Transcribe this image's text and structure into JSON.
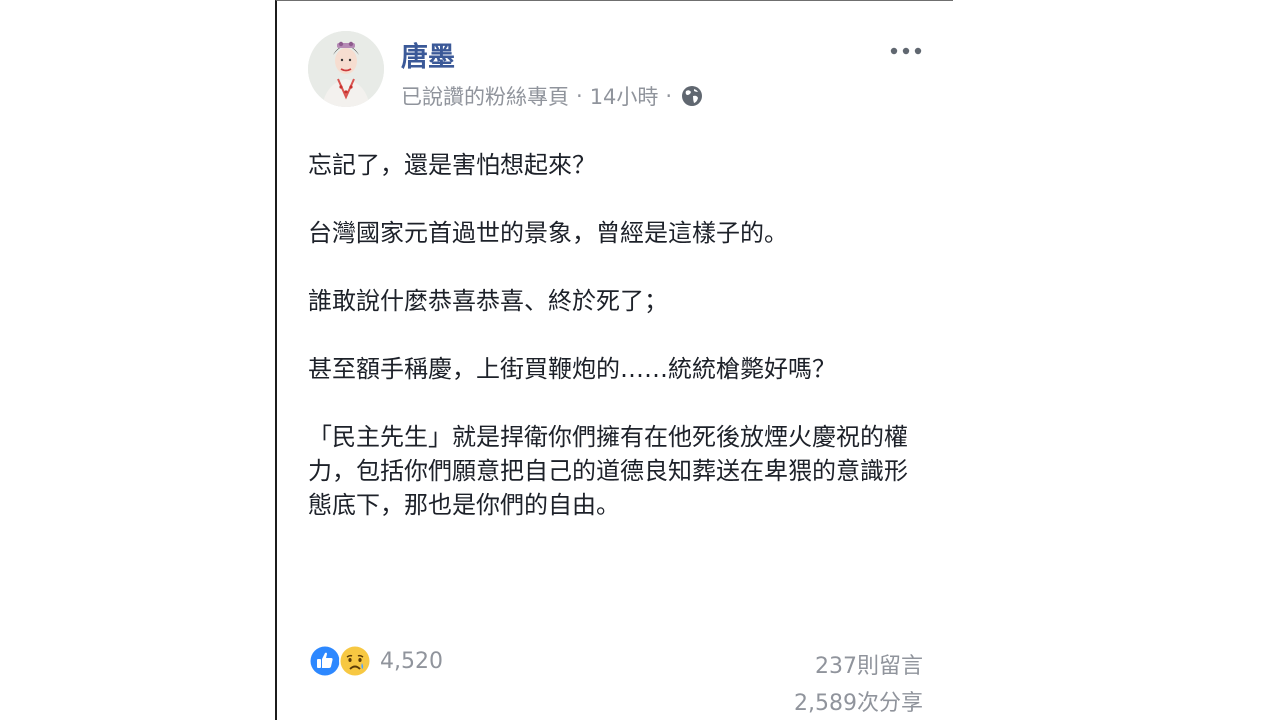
{
  "post": {
    "author": "唐墨",
    "subtitle": "已說讚的粉絲專頁",
    "separator": "·",
    "timestamp": "14小時",
    "audience_icon": "globe-icon",
    "more_icon": "ellipsis-icon",
    "paragraphs": [
      "忘記了，還是害怕想起來？",
      "台灣國家元首過世的景象，曾經是這樣子的。",
      "誰敢說什麼恭喜恭喜、終於死了；",
      "甚至額手稱慶，上街買鞭炮的……統統槍斃好嗎？",
      "「民主先生」就是捍衛你們擁有在他死後放煙火慶祝的權力，包括你們願意把自己的道德良知葬送在卑猥的意識形態底下，那也是你們的自由。"
    ]
  },
  "footer": {
    "reaction_icons": [
      "like-icon",
      "sad-icon"
    ],
    "reaction_count": "4,520",
    "comments": "237則留言",
    "shares": "2,589次分享"
  },
  "colors": {
    "author": "#3b5998",
    "meta": "#90949c",
    "text": "#1d2129",
    "like": "#2d88ff",
    "sad": "#f7c842"
  }
}
